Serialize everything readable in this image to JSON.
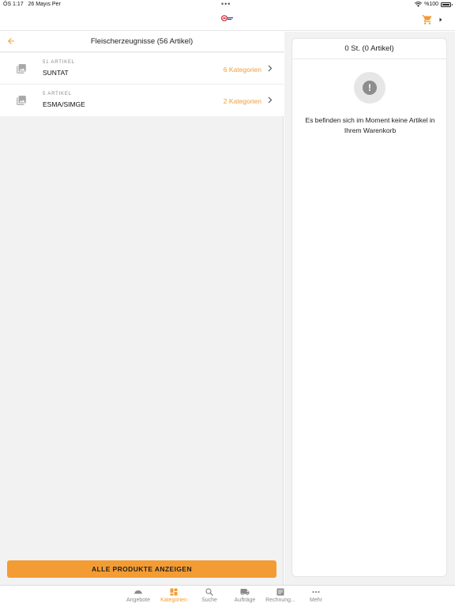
{
  "status_bar": {
    "time": "ÖS 1:17",
    "date": "26 Mayıs Per",
    "battery": "%100",
    "dots": "•••"
  },
  "header": {
    "logo_icon": "brand-logo",
    "cart_icon": "shopping-cart-icon"
  },
  "category_panel": {
    "title": "Fleischerzeugnisse (56 Artikel)",
    "items": [
      {
        "count": "51 ARTIKEL",
        "name": "SUNTAT",
        "subcategories": "6 Kategorien"
      },
      {
        "count": "5 ARTIKEL",
        "name": "ESMA/SIMGE",
        "subcategories": "2 Kategorien"
      }
    ],
    "all_products_button": "ALLE PRODUKTE ANZEIGEN"
  },
  "cart": {
    "header": "0 St. (0 Artikel)",
    "empty_icon": "exclamation-icon",
    "empty_message": "Es befinden sich im Moment keine Artikel in Ihrem Warenkorb"
  },
  "tab_bar": {
    "tabs": [
      {
        "label": "Angebote",
        "icon": "offers-icon",
        "active": false
      },
      {
        "label": "Kategorien",
        "icon": "categories-icon",
        "active": true
      },
      {
        "label": "Suche",
        "icon": "search-icon",
        "active": false
      },
      {
        "label": "Aufträge",
        "icon": "truck-icon",
        "active": false
      },
      {
        "label": "Rechnung...",
        "icon": "invoice-icon",
        "active": false
      },
      {
        "label": "Mehr",
        "icon": "more-icon",
        "active": false
      }
    ]
  },
  "colors": {
    "accent": "#f39c34",
    "panel_background": "#f2f2f2",
    "muted_text": "#8a8a8a"
  }
}
